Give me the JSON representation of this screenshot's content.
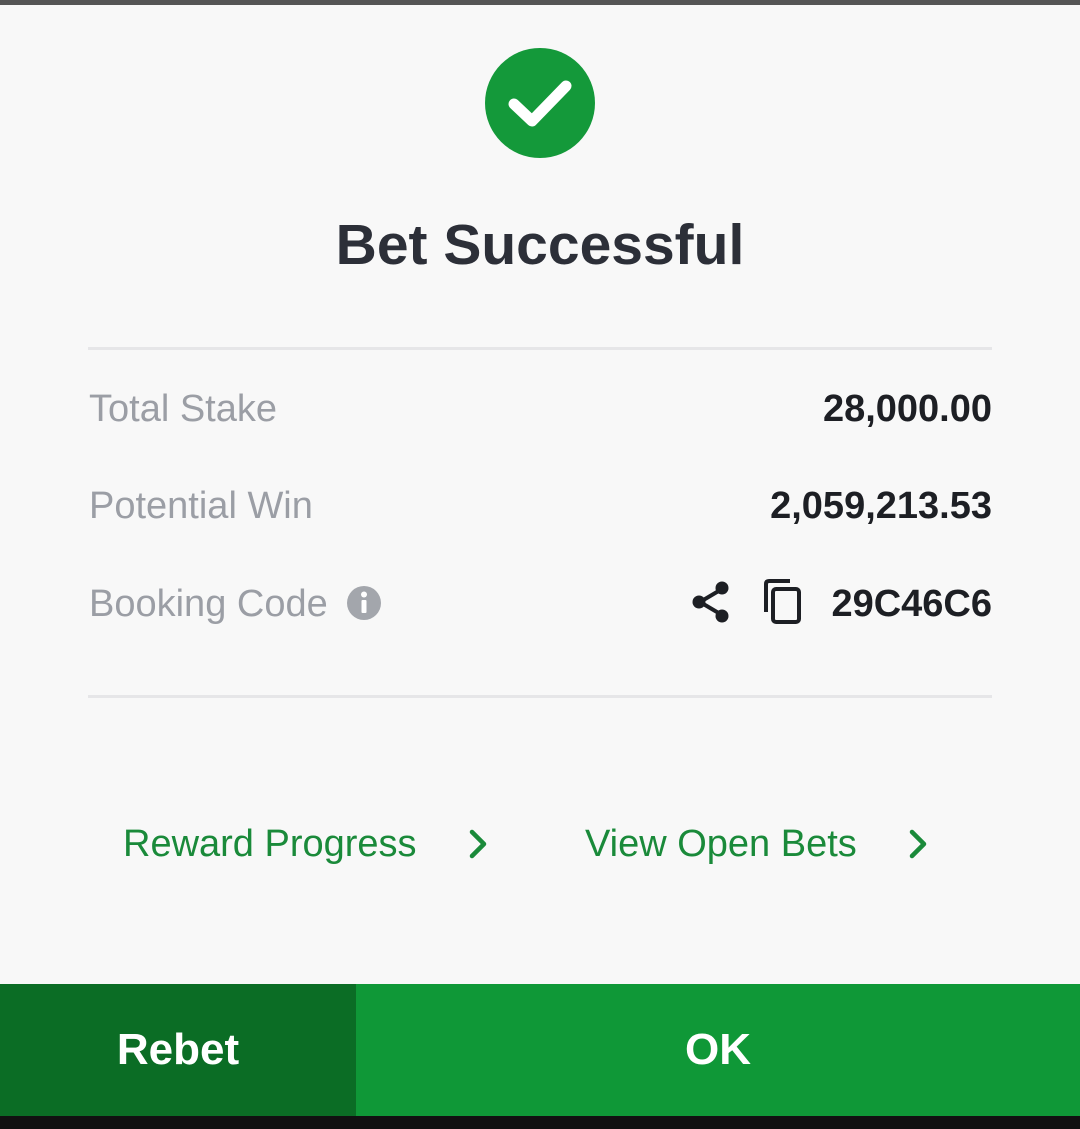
{
  "dialog": {
    "title": "Bet Successful",
    "rows": [
      {
        "label": "Total Stake",
        "value": "28,000.00"
      },
      {
        "label": "Potential Win",
        "value": "2,059,213.53"
      },
      {
        "label": "Booking Code",
        "value": "29C46C6"
      }
    ],
    "links": [
      {
        "label": "Reward Progress"
      },
      {
        "label": "View Open Bets"
      }
    ],
    "buttons": {
      "rebet": "Rebet",
      "ok": "OK"
    }
  },
  "icons": {
    "success": "check-circle-icon",
    "info": "info-icon",
    "share": "share-icon",
    "copy": "copy-icon",
    "chevron": "chevron-right-icon"
  },
  "colors": {
    "success_green": "#14993a",
    "link_green": "#1a8a3a",
    "rebet_bg": "#0b6d25",
    "ok_bg": "#0f9837",
    "title_text": "#2c2f38",
    "label_text": "#9b9ea5",
    "value_text": "#1d1f24"
  }
}
